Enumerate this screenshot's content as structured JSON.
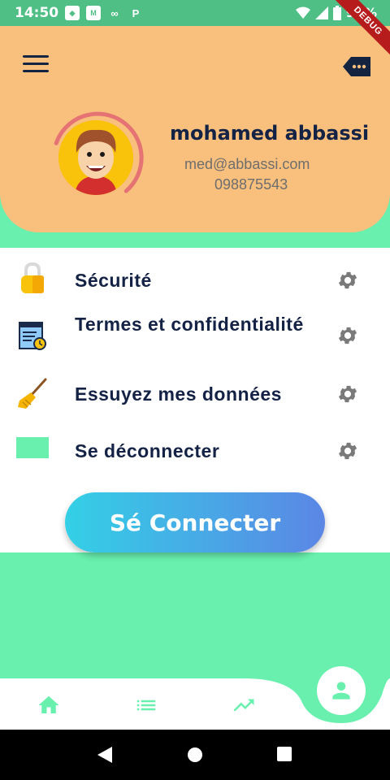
{
  "status_bar": {
    "time": "14:50",
    "battery": "99%",
    "app_icons": [
      "game-icon",
      "mail-icon",
      "infinity-icon",
      "paypal-icon"
    ]
  },
  "debug_banner": "DEBUG",
  "header": {
    "user_name": "mohamed abbassi",
    "email": "med@abbassi.com",
    "phone": "098875543"
  },
  "menu": {
    "items": [
      {
        "label": "Sécurité",
        "icon": "lock-icon"
      },
      {
        "label": "Termes et confidentialité",
        "icon": "document-icon"
      },
      {
        "label": "Essuyez mes données",
        "icon": "broom-icon"
      },
      {
        "label": "Se déconnecter",
        "icon": "logout-icon"
      }
    ],
    "connect_button": "Sé Connecter"
  },
  "bottom_nav": {
    "items": [
      "home-icon",
      "list-icon",
      "trending-icon"
    ],
    "active": "profile-icon"
  },
  "colors": {
    "accent": "#69F0AE",
    "header_bg": "#F8BF7D",
    "text_dark": "#132245",
    "gradient_start": "#33D0E6",
    "gradient_end": "#5B86E5"
  }
}
